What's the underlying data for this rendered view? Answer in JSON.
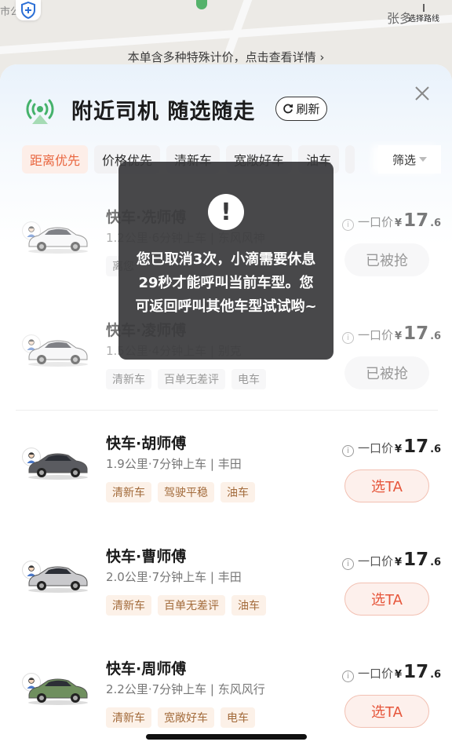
{
  "map": {
    "left_text": "市公",
    "right_text": "张多",
    "route_label": "选择路线",
    "notice": "本单含多种特殊计价，点击查看详情 ›"
  },
  "header": {
    "title": "附近司机 随选随走",
    "refresh_label": "刷新"
  },
  "filters": {
    "items": [
      "距离优先",
      "价格优先",
      "清新车",
      "宽敞好车",
      "油车"
    ],
    "screen_label": "筛选"
  },
  "drivers": [
    {
      "name": "快车·冼师傅",
      "info": "1.2公里·6分钟上车 | 东风风神",
      "tags": [
        "离您"
      ],
      "price_label": "一口价",
      "currency": "¥",
      "price_int": "17",
      "price_dec": ".6",
      "action": "已被抢",
      "status": "taken",
      "car_color": "#f4f4f6"
    },
    {
      "name": "快车·凌师傅",
      "info": "1.5公里·4分钟上车 | 别克",
      "tags": [
        "清新车",
        "百单无差评",
        "电车"
      ],
      "price_label": "一口价",
      "currency": "¥",
      "price_int": "17",
      "price_dec": ".6",
      "action": "已被抢",
      "status": "taken",
      "car_color": "#f2f2f4"
    },
    {
      "name": "快车·胡师傅",
      "info": "1.9公里·7分钟上车 | 丰田",
      "tags": [
        "清新车",
        "驾驶平稳",
        "油车"
      ],
      "price_label": "一口价",
      "currency": "¥",
      "price_int": "17",
      "price_dec": ".6",
      "action": "选TA",
      "status": "available",
      "car_color": "#5a5b60"
    },
    {
      "name": "快车·曹师傅",
      "info": "2.0公里·7分钟上车 | 丰田",
      "tags": [
        "清新车",
        "百单无差评",
        "油车"
      ],
      "price_label": "一口价",
      "currency": "¥",
      "price_int": "17",
      "price_dec": ".6",
      "action": "选TA",
      "status": "available",
      "car_color": "#c9c9cc"
    },
    {
      "name": "快车·周师傅",
      "info": "2.2公里·7分钟上车 | 东风风行",
      "tags": [
        "清新车",
        "宽敞好车",
        "电车"
      ],
      "price_label": "一口价",
      "currency": "¥",
      "price_int": "17",
      "price_dec": ".6",
      "action": "选TA",
      "status": "available",
      "car_color": "#6f8f5e"
    }
  ],
  "toast": {
    "message": "您已取消3次，小滴需要休息29秒才能呼叫当前车型。您可返回呼叫其他车型试试哟~",
    "icon": "exclamation-icon"
  },
  "colors": {
    "accent": "#e9663f",
    "select_text": "#e6553a",
    "warm_tag": "#a26a3a",
    "radar_green": "#45b26b"
  }
}
